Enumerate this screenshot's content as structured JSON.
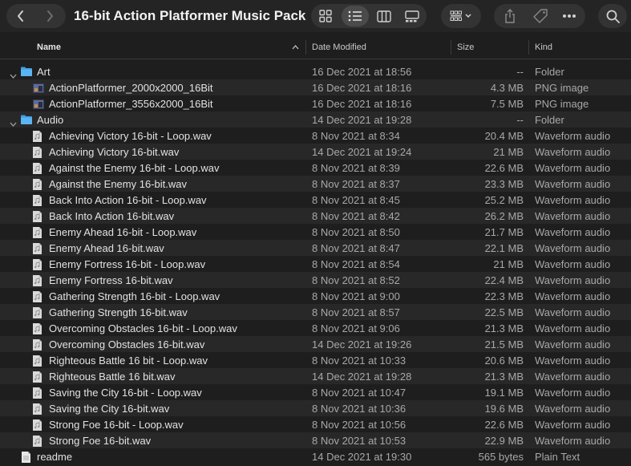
{
  "window": {
    "title": "16-bit Action Platformer Music Pack"
  },
  "toolbar": {
    "back_icon": "chevron-left-icon",
    "forward_icon": "chevron-right-icon",
    "views": [
      "icon-view-icon",
      "list-view-icon",
      "column-view-icon",
      "gallery-view-icon"
    ],
    "active_view": "list-view-icon",
    "group_icon": "group-grid-icon",
    "share_icon": "share-icon",
    "tag_icon": "tag-icon",
    "more_icon": "ellipsis-icon",
    "search_icon": "search-icon"
  },
  "columns": {
    "name": "Name",
    "date": "Date Modified",
    "size": "Size",
    "kind": "Kind"
  },
  "rows": [
    {
      "name": "Art",
      "date": "16 Dec 2021 at 18:56",
      "size": "--",
      "kind": "Folder",
      "type": "folder",
      "indent": 0
    },
    {
      "name": "ActionPlatformer_2000x2000_16Bit",
      "date": "16 Dec 2021 at 18:16",
      "size": "4.3 MB",
      "kind": "PNG image",
      "type": "png",
      "indent": 1
    },
    {
      "name": "ActionPlatformer_3556x2000_16Bit",
      "date": "16 Dec 2021 at 18:16",
      "size": "7.5 MB",
      "kind": "PNG image",
      "type": "png",
      "indent": 1
    },
    {
      "name": "Audio",
      "date": "14 Dec 2021 at 19:28",
      "size": "--",
      "kind": "Folder",
      "type": "folder",
      "indent": 0
    },
    {
      "name": "Achieving Victory 16-bit - Loop.wav",
      "date": "8 Nov 2021 at 8:34",
      "size": "20.4 MB",
      "kind": "Waveform audio",
      "type": "audio",
      "indent": 1
    },
    {
      "name": "Achieving Victory 16-bit.wav",
      "date": "14 Dec 2021 at 19:24",
      "size": "21 MB",
      "kind": "Waveform audio",
      "type": "audio",
      "indent": 1
    },
    {
      "name": "Against the Enemy 16-bit - Loop.wav",
      "date": "8 Nov 2021 at 8:39",
      "size": "22.6 MB",
      "kind": "Waveform audio",
      "type": "audio",
      "indent": 1
    },
    {
      "name": "Against the Enemy 16-bit.wav",
      "date": "8 Nov 2021 at 8:37",
      "size": "23.3 MB",
      "kind": "Waveform audio",
      "type": "audio",
      "indent": 1
    },
    {
      "name": "Back Into Action 16-bit - Loop.wav",
      "date": "8 Nov 2021 at 8:45",
      "size": "25.2 MB",
      "kind": "Waveform audio",
      "type": "audio",
      "indent": 1
    },
    {
      "name": "Back Into Action 16-bit.wav",
      "date": "8 Nov 2021 at 8:42",
      "size": "26.2 MB",
      "kind": "Waveform audio",
      "type": "audio",
      "indent": 1
    },
    {
      "name": "Enemy Ahead 16-bit - Loop.wav",
      "date": "8 Nov 2021 at 8:50",
      "size": "21.7 MB",
      "kind": "Waveform audio",
      "type": "audio",
      "indent": 1
    },
    {
      "name": "Enemy Ahead 16-bit.wav",
      "date": "8 Nov 2021 at 8:47",
      "size": "22.1 MB",
      "kind": "Waveform audio",
      "type": "audio",
      "indent": 1
    },
    {
      "name": "Enemy Fortress 16-bit - Loop.wav",
      "date": "8 Nov 2021 at 8:54",
      "size": "21 MB",
      "kind": "Waveform audio",
      "type": "audio",
      "indent": 1
    },
    {
      "name": "Enemy Fortress 16-bit.wav",
      "date": "8 Nov 2021 at 8:52",
      "size": "22.4 MB",
      "kind": "Waveform audio",
      "type": "audio",
      "indent": 1
    },
    {
      "name": "Gathering Strength 16-bit - Loop.wav",
      "date": "8 Nov 2021 at 9:00",
      "size": "22.3 MB",
      "kind": "Waveform audio",
      "type": "audio",
      "indent": 1
    },
    {
      "name": "Gathering Strength 16-bit.wav",
      "date": "8 Nov 2021 at 8:57",
      "size": "22.5 MB",
      "kind": "Waveform audio",
      "type": "audio",
      "indent": 1
    },
    {
      "name": "Overcoming Obstacles 16-bit - Loop.wav",
      "date": "8 Nov 2021 at 9:06",
      "size": "21.3 MB",
      "kind": "Waveform audio",
      "type": "audio",
      "indent": 1
    },
    {
      "name": "Overcoming Obstacles 16-bit.wav",
      "date": "14 Dec 2021 at 19:26",
      "size": "21.5 MB",
      "kind": "Waveform audio",
      "type": "audio",
      "indent": 1
    },
    {
      "name": "Righteous Battle 16 bit - Loop.wav",
      "date": "8 Nov 2021 at 10:33",
      "size": "20.6 MB",
      "kind": "Waveform audio",
      "type": "audio",
      "indent": 1
    },
    {
      "name": "Righteous Battle 16 bit.wav",
      "date": "14 Dec 2021 at 19:28",
      "size": "21.3 MB",
      "kind": "Waveform audio",
      "type": "audio",
      "indent": 1
    },
    {
      "name": "Saving the City 16-bit - Loop.wav",
      "date": "8 Nov 2021 at 10:47",
      "size": "19.1 MB",
      "kind": "Waveform audio",
      "type": "audio",
      "indent": 1
    },
    {
      "name": "Saving the City 16-bit.wav",
      "date": "8 Nov 2021 at 10:36",
      "size": "19.6 MB",
      "kind": "Waveform audio",
      "type": "audio",
      "indent": 1
    },
    {
      "name": "Strong Foe 16-bit - Loop.wav",
      "date": "8 Nov 2021 at 10:56",
      "size": "22.6 MB",
      "kind": "Waveform audio",
      "type": "audio",
      "indent": 1
    },
    {
      "name": "Strong Foe 16-bit.wav",
      "date": "8 Nov 2021 at 10:53",
      "size": "22.9 MB",
      "kind": "Waveform audio",
      "type": "audio",
      "indent": 1
    },
    {
      "name": "readme",
      "date": "14 Dec 2021 at 19:30",
      "size": "565 bytes",
      "kind": "Plain Text",
      "type": "text",
      "indent": 0
    }
  ],
  "colors": {
    "folder": "#3aa0e8",
    "background": "#1e1e1e",
    "alt_row": "#282828"
  }
}
